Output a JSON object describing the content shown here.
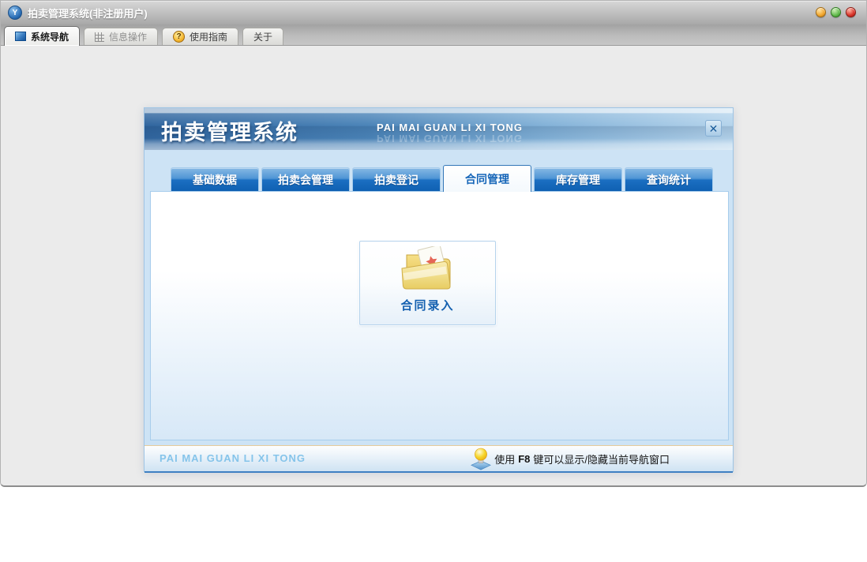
{
  "window": {
    "title": "拍卖管理系统(非注册用户)",
    "logo_glyph": "Y",
    "controls": [
      {
        "name": "minimize",
        "color": "#f2a72e"
      },
      {
        "name": "maximize",
        "color": "#63bb4e"
      },
      {
        "name": "close",
        "color": "#d8342a"
      }
    ],
    "tabs": [
      {
        "label": "系统导航",
        "icon": "blue-square-icon",
        "state": "active"
      },
      {
        "label": "信息操作",
        "icon": "grid-icon",
        "state": "disabled"
      },
      {
        "label": "使用指南",
        "icon": "question-circle-icon",
        "state": "normal"
      },
      {
        "label": "关于",
        "icon": "none",
        "state": "normal"
      }
    ]
  },
  "glyphs": {
    "question": "?",
    "close": "✕"
  },
  "dialog": {
    "title": "拍卖管理系统",
    "subtitle": "PAI MAI GUAN LI XI TONG",
    "tabs": [
      {
        "label": "基础数据",
        "active": false
      },
      {
        "label": "拍卖会管理",
        "active": false
      },
      {
        "label": "拍卖登记",
        "active": false
      },
      {
        "label": "合同管理",
        "active": true
      },
      {
        "label": "库存管理",
        "active": false
      },
      {
        "label": "查询统计",
        "active": false
      }
    ],
    "shortcuts": [
      {
        "label": "合同录入",
        "icon": "folder-document-icon"
      }
    ],
    "footer": {
      "brand": "PAI MAI GUAN LI XI TONG",
      "tip_prefix": "使用",
      "tip_key": "F8",
      "tip_suffix": "键可以显示/隐藏当前导航窗口",
      "tip_icon": "lightbulb-icon"
    }
  },
  "colors": {
    "accent_blue": "#1668c1",
    "active_tab_text": "#1565b8",
    "header_gradient_left": "#31669f",
    "header_gradient_right": "#b5d4ec",
    "brand_text": "#85c4ea",
    "dialog_bg": "#cde3f5",
    "titlebar_gray": "#bcbcbc",
    "desktop_gray": "#ebebeb"
  }
}
